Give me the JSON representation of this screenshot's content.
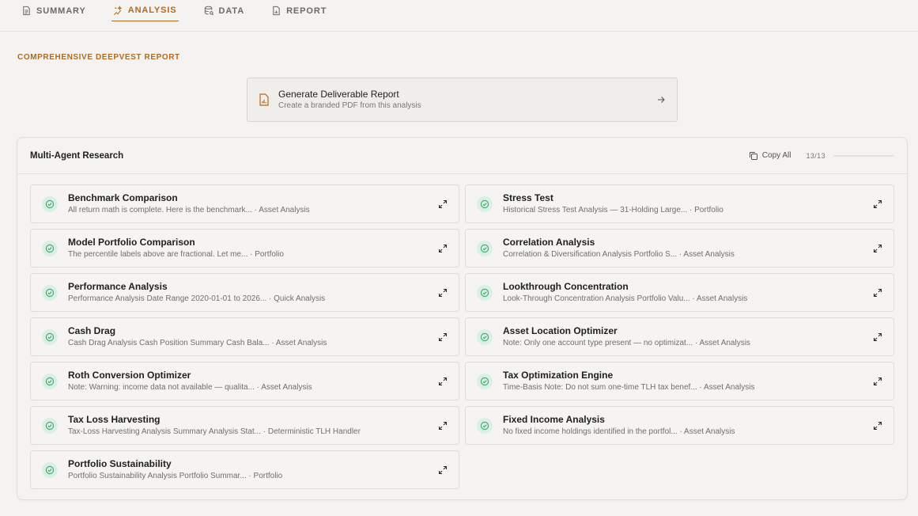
{
  "tabs": [
    {
      "label": "SUMMARY",
      "icon": "document-icon",
      "active": false
    },
    {
      "label": "ANALYSIS",
      "icon": "sparkle-chart-icon",
      "active": true
    },
    {
      "label": "DATA",
      "icon": "database-search-icon",
      "active": false
    },
    {
      "label": "REPORT",
      "icon": "report-file-icon",
      "active": false
    }
  ],
  "section_title": "COMPREHENSIVE DEEPVEST REPORT",
  "generate": {
    "title": "Generate Deliverable Report",
    "subtitle": "Create a branded PDF from this analysis"
  },
  "panel": {
    "title": "Multi-Agent Research",
    "copy_all": "Copy All",
    "count": "13/13",
    "progress": 1.0
  },
  "colors": {
    "accent": "#b26a1e",
    "check_bg": "#dcefe4",
    "check_fg": "#3fae6e"
  },
  "agents": [
    {
      "title": "Benchmark Comparison",
      "summary": "All return math is complete. Here is the benchmark... · Asset Analysis"
    },
    {
      "title": "Stress Test",
      "summary": "Historical Stress Test Analysis — 31-Holding Large... · Portfolio"
    },
    {
      "title": "Model Portfolio Comparison",
      "summary": "The percentile labels above are fractional. Let me... · Portfolio"
    },
    {
      "title": "Correlation Analysis",
      "summary": "Correlation & Diversification Analysis Portfolio S... · Asset Analysis"
    },
    {
      "title": "Performance Analysis",
      "summary": "Performance Analysis Date Range 2020-01-01 to 2026... · Quick Analysis"
    },
    {
      "title": "Lookthrough Concentration",
      "summary": "Look-Through Concentration Analysis Portfolio Valu... · Asset Analysis"
    },
    {
      "title": "Cash Drag",
      "summary": "Cash Drag Analysis Cash Position Summary Cash Bala... · Asset Analysis"
    },
    {
      "title": "Asset Location Optimizer",
      "summary": "Note: Only one account type present — no optimizat... · Asset Analysis"
    },
    {
      "title": "Roth Conversion Optimizer",
      "summary": "Note: Warning: income data not available — qualita... · Asset Analysis"
    },
    {
      "title": "Tax Optimization Engine",
      "summary": "Time-Basis Note: Do not sum one-time TLH tax benef... · Asset Analysis"
    },
    {
      "title": "Tax Loss Harvesting",
      "summary": "Tax-Loss Harvesting Analysis Summary Analysis Stat... · Deterministic TLH Handler"
    },
    {
      "title": "Fixed Income Analysis",
      "summary": "No fixed income holdings identified in the portfol... · Asset Analysis"
    },
    {
      "title": "Portfolio Sustainability",
      "summary": "Portfolio Sustainability Analysis Portfolio Summar... · Portfolio"
    }
  ]
}
